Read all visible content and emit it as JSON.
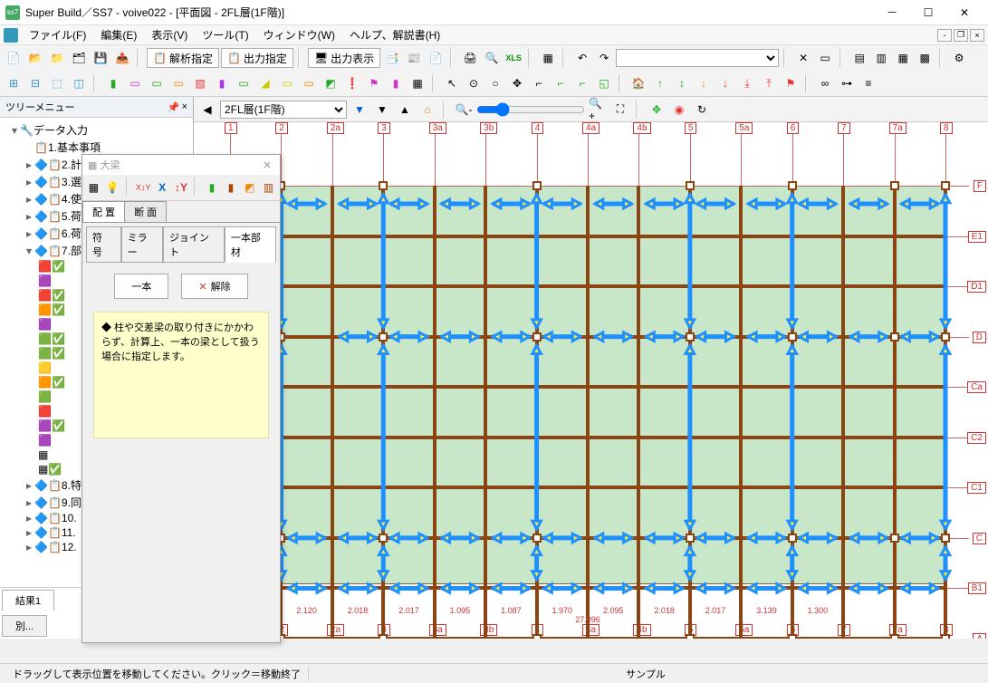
{
  "title": "Super Build／SS7 - voive022 - [平面図 - 2FL層(1F階)]",
  "menu": {
    "items": [
      "ファイル(F)",
      "編集(E)",
      "表示(V)",
      "ツール(T)",
      "ウィンドウ(W)",
      "ヘルプ、解説書(H)"
    ]
  },
  "toolbar_labels": {
    "kaiseki": "解析指定",
    "shutsuryoku": "出力指定",
    "shutsu_hyoji": "出力表示"
  },
  "floor_combo": "2FL層(1F階)",
  "tree": {
    "header": "ツリーメニュー",
    "root": "データ入力",
    "items": [
      "1.基本事項",
      "2.計",
      "3.選",
      "4.使",
      "5.荷",
      "6.荷",
      "7.部",
      "8.特",
      "9.同",
      "10.",
      "11.",
      "12."
    ],
    "result_tab": "結果1",
    "alt_tab": "別..."
  },
  "palette": {
    "title": "大梁",
    "tabs": [
      "配 置",
      "断 面"
    ],
    "subtabs": [
      "符 号",
      "ミラー",
      "ジョイント",
      "一本部材"
    ],
    "btn1": "一本",
    "btn2": "解除",
    "help": "◆ 柱や交差梁の取り付きにかかわらず、計算上、一本の梁として扱う場合に指定します。"
  },
  "grid": {
    "x_labels": [
      "1",
      "2",
      "2a",
      "3",
      "3a",
      "3b",
      "4",
      "4a",
      "4b",
      "5",
      "5a",
      "6",
      "7",
      "7a",
      "8"
    ],
    "y_labels": [
      "F",
      "E1",
      "D1",
      "D",
      "Ca",
      "C2",
      "C1",
      "C",
      "B1",
      "A"
    ],
    "dims": [
      "2.120",
      "2.120",
      "2.018",
      "2.017",
      "1.095",
      "1.087",
      "1.970",
      "2.095",
      "2.018",
      "2.017",
      "3.139",
      "1.300"
    ],
    "total_dim": "27.096"
  },
  "status": {
    "left": "ドラッグして表示位置を移動してください。クリック＝移動終了",
    "center": "サンプル"
  }
}
